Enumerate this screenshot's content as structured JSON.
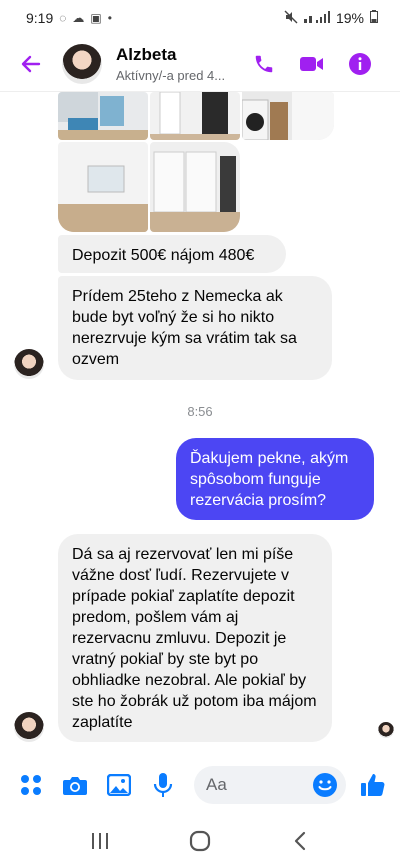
{
  "status_bar": {
    "time": "9:19",
    "battery": "19%"
  },
  "header": {
    "name": "Alzbeta",
    "status": "Aktívny/-a pred 4..."
  },
  "messages": {
    "deposit": "Depozit 500€ nájom 480€",
    "arrival": "Prídem 25teho z Nemecka ak bude byt voľný že si ho nikto nerezrvuje kým sa vrátim tak sa ozvem",
    "time": "8:56",
    "question": "Ďakujem pekne, akým spôsobom funguje rezervácia prosím?",
    "reply": "Dá sa aj rezervovať len mi píše vážne dosť ľudí. Rezervujete v prípade pokiaľ zaplatíte depozit predom, pošlem vám aj rezervacnu zmluvu. Depozit je vratný pokiaľ by ste byt po obhliadke nezobral. Ale pokiaľ by ste ho žobrák už potom iba májom zaplatíte"
  },
  "composer": {
    "placeholder": "Aa"
  },
  "colors": {
    "accent": "#a020f0",
    "outgoing": "#4c46f3",
    "incoming": "#f0f0f0",
    "toolbar_blue": "#0a7cff"
  },
  "icons": [
    "back-arrow-icon",
    "phone-icon",
    "video-icon",
    "info-icon",
    "apps-icon",
    "camera-icon",
    "gallery-icon",
    "microphone-icon",
    "emoji-icon",
    "like-icon",
    "recents-icon",
    "home-icon",
    "back-icon"
  ]
}
